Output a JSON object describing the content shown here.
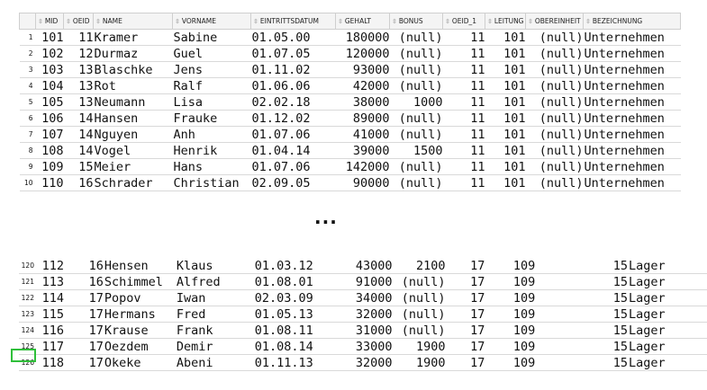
{
  "columns": [
    "MID",
    "OEID",
    "NAME",
    "VORNAME",
    "EINTRITTSDATUM",
    "GEHALT",
    "BONUS",
    "OEID_1",
    "LEITUNG",
    "OBEREINHEIT",
    "BEZEICHNUNG"
  ],
  "ellipsis": "...",
  "top_rows": [
    {
      "n": "1",
      "mid": "101",
      "oeid": "11",
      "name": "Kramer",
      "vorname": "Sabine",
      "datum": "01.05.00",
      "gehalt": "180000",
      "bonus": "(null)",
      "oeid1": "11",
      "leitung": "101",
      "ober": "(null)",
      "bez": "Unternehmen"
    },
    {
      "n": "2",
      "mid": "102",
      "oeid": "12",
      "name": "Durmaz",
      "vorname": "Guel",
      "datum": "01.07.05",
      "gehalt": "120000",
      "bonus": "(null)",
      "oeid1": "11",
      "leitung": "101",
      "ober": "(null)",
      "bez": "Unternehmen"
    },
    {
      "n": "3",
      "mid": "103",
      "oeid": "13",
      "name": "Blaschke",
      "vorname": "Jens",
      "datum": "01.11.02",
      "gehalt": "93000",
      "bonus": "(null)",
      "oeid1": "11",
      "leitung": "101",
      "ober": "(null)",
      "bez": "Unternehmen"
    },
    {
      "n": "4",
      "mid": "104",
      "oeid": "13",
      "name": "Rot",
      "vorname": "Ralf",
      "datum": "01.06.06",
      "gehalt": "42000",
      "bonus": "(null)",
      "oeid1": "11",
      "leitung": "101",
      "ober": "(null)",
      "bez": "Unternehmen"
    },
    {
      "n": "5",
      "mid": "105",
      "oeid": "13",
      "name": "Neumann",
      "vorname": "Lisa",
      "datum": "02.02.18",
      "gehalt": "38000",
      "bonus": "1000",
      "oeid1": "11",
      "leitung": "101",
      "ober": "(null)",
      "bez": "Unternehmen"
    },
    {
      "n": "6",
      "mid": "106",
      "oeid": "14",
      "name": "Hansen",
      "vorname": "Frauke",
      "datum": "01.12.02",
      "gehalt": "89000",
      "bonus": "(null)",
      "oeid1": "11",
      "leitung": "101",
      "ober": "(null)",
      "bez": "Unternehmen"
    },
    {
      "n": "7",
      "mid": "107",
      "oeid": "14",
      "name": "Nguyen",
      "vorname": "Anh",
      "datum": "01.07.06",
      "gehalt": "41000",
      "bonus": "(null)",
      "oeid1": "11",
      "leitung": "101",
      "ober": "(null)",
      "bez": "Unternehmen"
    },
    {
      "n": "8",
      "mid": "108",
      "oeid": "14",
      "name": "Vogel",
      "vorname": "Henrik",
      "datum": "01.04.14",
      "gehalt": "39000",
      "bonus": "1500",
      "oeid1": "11",
      "leitung": "101",
      "ober": "(null)",
      "bez": "Unternehmen"
    },
    {
      "n": "9",
      "mid": "109",
      "oeid": "15",
      "name": "Meier",
      "vorname": "Hans",
      "datum": "01.07.06",
      "gehalt": "142000",
      "bonus": "(null)",
      "oeid1": "11",
      "leitung": "101",
      "ober": "(null)",
      "bez": "Unternehmen"
    },
    {
      "n": "10",
      "mid": "110",
      "oeid": "16",
      "name": "Schrader",
      "vorname": "Christian",
      "datum": "02.09.05",
      "gehalt": "90000",
      "bonus": "(null)",
      "oeid1": "11",
      "leitung": "101",
      "ober": "(null)",
      "bez": "Unternehmen"
    }
  ],
  "bottom_rows": [
    {
      "n": "120",
      "mid": "112",
      "oeid": "16",
      "name": "Hensen",
      "vorname": "Klaus",
      "datum": "01.03.12",
      "gehalt": "43000",
      "bonus": "2100",
      "oeid1": "17",
      "leitung": "109",
      "ober": "15",
      "bez": "Lager"
    },
    {
      "n": "121",
      "mid": "113",
      "oeid": "16",
      "name": "Schimmel",
      "vorname": "Alfred",
      "datum": "01.08.01",
      "gehalt": "91000",
      "bonus": "(null)",
      "oeid1": "17",
      "leitung": "109",
      "ober": "15",
      "bez": "Lager"
    },
    {
      "n": "122",
      "mid": "114",
      "oeid": "17",
      "name": "Popov",
      "vorname": "Iwan",
      "datum": "02.03.09",
      "gehalt": "34000",
      "bonus": "(null)",
      "oeid1": "17",
      "leitung": "109",
      "ober": "15",
      "bez": "Lager"
    },
    {
      "n": "123",
      "mid": "115",
      "oeid": "17",
      "name": "Hermans",
      "vorname": "Fred",
      "datum": "01.05.13",
      "gehalt": "32000",
      "bonus": "(null)",
      "oeid1": "17",
      "leitung": "109",
      "ober": "15",
      "bez": "Lager"
    },
    {
      "n": "124",
      "mid": "116",
      "oeid": "17",
      "name": "Krause",
      "vorname": "Frank",
      "datum": "01.08.11",
      "gehalt": "31000",
      "bonus": "(null)",
      "oeid1": "17",
      "leitung": "109",
      "ober": "15",
      "bez": "Lager"
    },
    {
      "n": "125",
      "mid": "117",
      "oeid": "17",
      "name": "Oezdem",
      "vorname": "Demir",
      "datum": "01.08.14",
      "gehalt": "33000",
      "bonus": "1900",
      "oeid1": "17",
      "leitung": "109",
      "ober": "15",
      "bez": "Lager"
    },
    {
      "n": "126",
      "mid": "118",
      "oeid": "17",
      "name": "Okeke",
      "vorname": "Abeni",
      "datum": "01.11.13",
      "gehalt": "32000",
      "bonus": "1900",
      "oeid1": "17",
      "leitung": "109",
      "ober": "15",
      "bez": "Lager"
    }
  ],
  "selected_row": "126",
  "colors": {
    "highlight": "#2fbf3a",
    "header_bg": "#f4f4f4",
    "grid_line": "#d9d9d9"
  },
  "icons": {
    "sort": "sort-arrows-icon"
  }
}
